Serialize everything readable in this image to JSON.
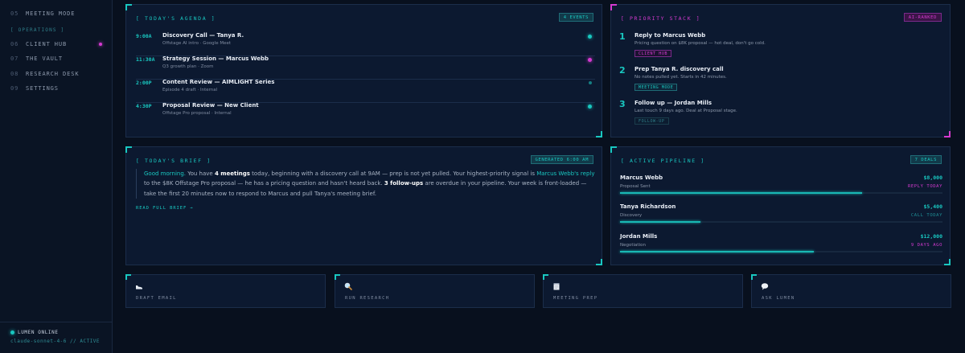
{
  "sidebar": {
    "top_items": [
      {
        "num": "05",
        "label": "MEETING MODE"
      }
    ],
    "section_label": "[ OPERATIONS ]",
    "items": [
      {
        "num": "06",
        "label": "CLIENT HUB"
      },
      {
        "num": "07",
        "label": "THE VAULT"
      },
      {
        "num": "08",
        "label": "RESEARCH DESK"
      },
      {
        "num": "09",
        "label": "SETTINGS"
      }
    ],
    "status": "LUMEN ONLINE",
    "model": "claude-sonnet-4-6 // ACTIVE"
  },
  "agenda": {
    "title": "[ TODAY'S AGENDA ]",
    "badge": "4 EVENTS",
    "events": [
      {
        "time": "9:00A",
        "title": "Discovery Call — Tanya R.",
        "sub": "Offstage AI intro · Google Meet",
        "dot": "cyan"
      },
      {
        "time": "11:30A",
        "title": "Strategy Session — Marcus Webb",
        "sub": "Q3 growth plan · Zoom",
        "dot": "magenta"
      },
      {
        "time": "2:00P",
        "title": "Content Review — AIMLIGHT Series",
        "sub": "Episode 4 draft · Internal",
        "dot": "dim"
      },
      {
        "time": "4:30P",
        "title": "Proposal Review — New Client",
        "sub": "Offstage Pro proposal · Internal",
        "dot": "cyan"
      }
    ]
  },
  "priority": {
    "title": "[ PRIORITY STACK ]",
    "badge": "AI-RANKED",
    "items": [
      {
        "num": "1",
        "title": "Reply to Marcus Webb",
        "sub": "Pricing question on $8K proposal — hot deal, don't go cold.",
        "tag": "CLIENT HUB"
      },
      {
        "num": "2",
        "title": "Prep Tanya R. discovery call",
        "sub": "No notes pulled yet. Starts in 42 minutes.",
        "tag": "MEETING MODE"
      },
      {
        "num": "3",
        "title": "Follow up — Jordan Mills",
        "sub": "Last touch 9 days ago. Deal at Proposal stage.",
        "tag": "FOLLOW-UP"
      }
    ]
  },
  "brief": {
    "title": "[ TODAY'S BRIEF ]",
    "badge": "GENERATED 6:00 AM",
    "greeting": "Good morning.",
    "t1": " You have ",
    "meetings": "4 meetings",
    "t2": " today, beginning with a discovery call at 9AM — prep is not yet pulled. Your highest-priority signal is ",
    "signal": "Marcus Webb's reply",
    "t3": " to the $8K Offstage Pro proposal — he has a pricing question and hasn't heard back. ",
    "followups": "3 follow-ups",
    "t4": " are overdue in your pipeline. Your week is front-loaded — take the first 20 minutes now to respond to Marcus and pull Tanya's meeting brief.",
    "read_more": "READ FULL BRIEF →"
  },
  "pipeline": {
    "title": "[ ACTIVE PIPELINE ]",
    "badge": "7 DEALS",
    "deals": [
      {
        "name": "Marcus Webb",
        "amount": "$8,000",
        "stage": "Proposal Sent",
        "action": "REPLY TODAY",
        "progress": 0.75
      },
      {
        "name": "Tanya Richardson",
        "amount": "$5,400",
        "stage": "Discovery",
        "action": "CALL TODAY",
        "progress": 0.25
      },
      {
        "name": "Jordan Mills",
        "amount": "$12,000",
        "stage": "Negotiation",
        "action": "9 DAYS AGO",
        "progress": 0.6
      }
    ]
  },
  "quick_actions": [
    {
      "label": "DRAFT EMAIL",
      "icon": "shoe-icon"
    },
    {
      "label": "RUN RESEARCH",
      "icon": "magnifier-icon"
    },
    {
      "label": "MEETING PREP",
      "icon": "notepad-icon"
    },
    {
      "label": "ASK LUMEN",
      "icon": "speech-bubble-icon"
    }
  ],
  "colors": {
    "accent": "#19c7c0",
    "accent2": "#d43ad0",
    "panel": "#0c1930",
    "bg": "#08101e"
  }
}
